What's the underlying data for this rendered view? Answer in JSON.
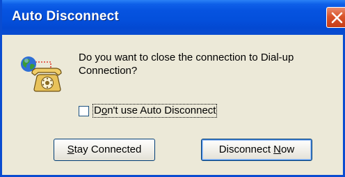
{
  "window": {
    "title": "Auto Disconnect"
  },
  "message": {
    "text": "Do you want to close the connection to Dial-up Connection?"
  },
  "checkbox": {
    "label_prefix": "D",
    "label_mnemonic": "o",
    "label_suffix": "n't use Auto Disconnect",
    "checked": false
  },
  "buttons": {
    "stay_mnemonic": "S",
    "stay_rest": "tay Connected",
    "disconnect_prefix": "Disconnect ",
    "disconnect_mnemonic": "N",
    "disconnect_suffix": "ow"
  },
  "icons": {
    "close": "close-icon",
    "dialup": "dialup-connection-icon"
  },
  "colors": {
    "titlebar": "#0450dc",
    "close_button": "#d9542b",
    "window_background": "#ece9d8",
    "default_button_focus": "#4b8ee8"
  }
}
